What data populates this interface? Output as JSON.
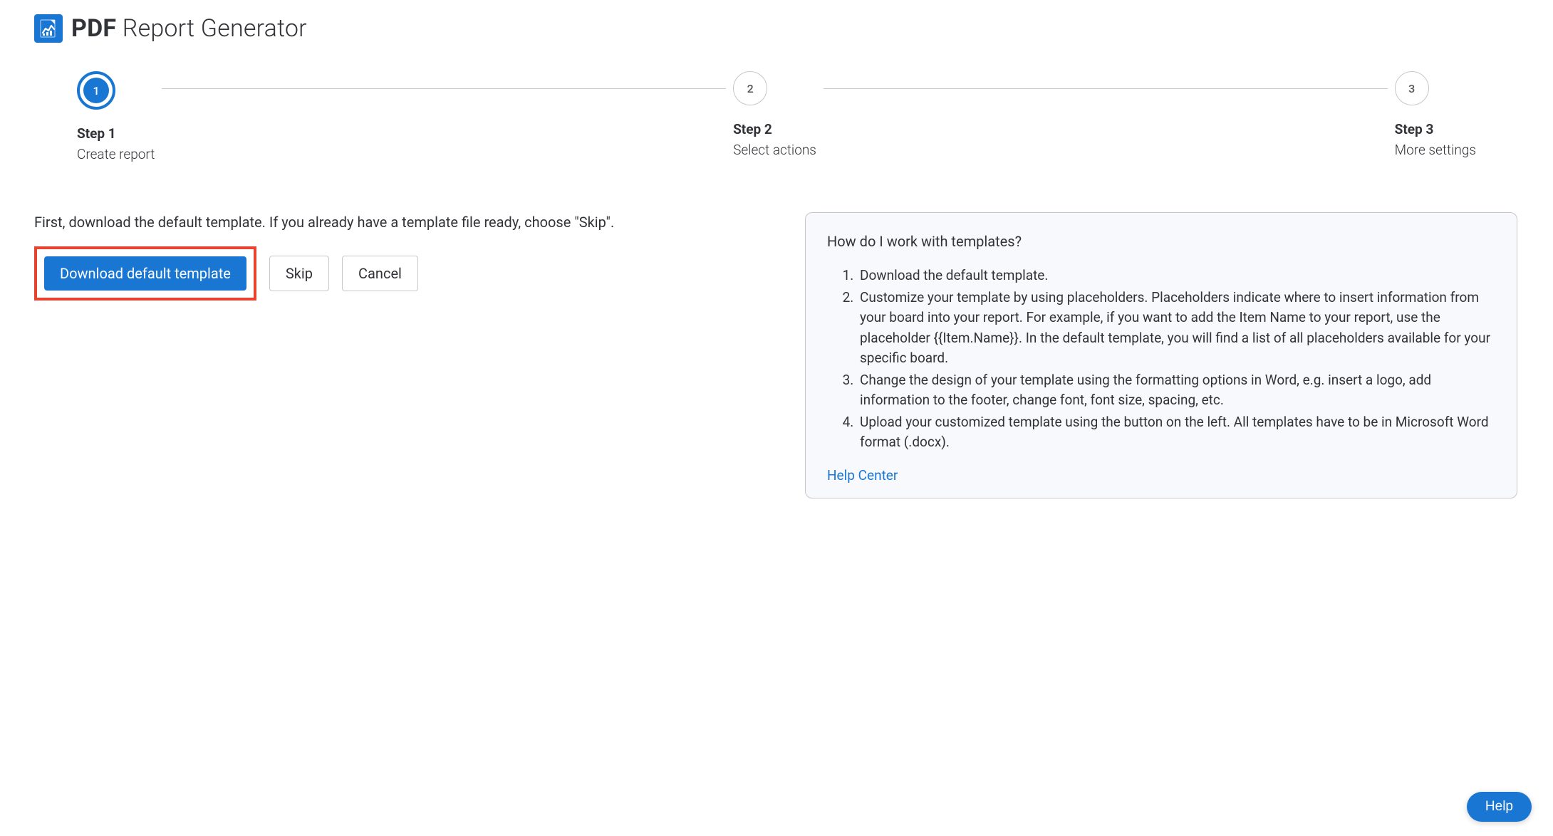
{
  "colors": {
    "accent": "#1976d2",
    "highlight_border": "#e8432f"
  },
  "header": {
    "title_bold": "PDF",
    "title_rest": " Report Generator"
  },
  "stepper": {
    "active_index": 0,
    "steps": [
      {
        "number": "1",
        "title": "Step 1",
        "desc": "Create report"
      },
      {
        "number": "2",
        "title": "Step 2",
        "desc": "Select actions"
      },
      {
        "number": "3",
        "title": "Step 3",
        "desc": "More settings"
      }
    ]
  },
  "left": {
    "instruction": "First, download the default template. If you already have a template file ready, choose \"Skip\".",
    "download_label": "Download default template",
    "skip_label": "Skip",
    "cancel_label": "Cancel"
  },
  "help_panel": {
    "title": "How do I work with templates?",
    "items": [
      "Download the default template.",
      "Customize your template by using placeholders. Placeholders indicate where to insert information from your board into your report. For example, if you want to add the Item Name to your report, use the placeholder {{Item.Name}}. In the default template, you will find a list of all placeholders available for your specific board.",
      "Change the design of your template using the formatting options in Word, e.g. insert a logo, add information to the footer, change font, font size, spacing, etc.",
      "Upload your customized template using the button on the left. All templates have to be in Microsoft Word format (.docx)."
    ],
    "link_label": "Help Center"
  },
  "help_button_label": "Help"
}
